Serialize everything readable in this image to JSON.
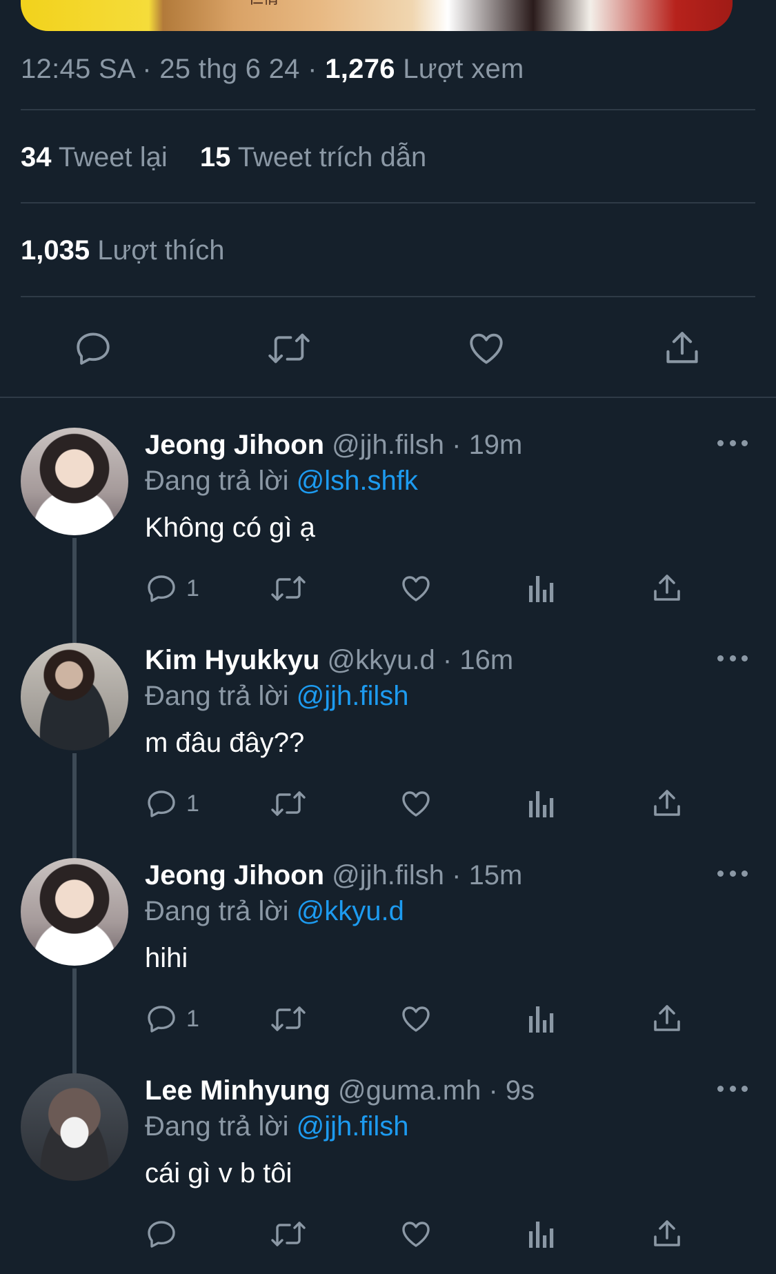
{
  "header": {
    "time": "12:45 SA",
    "date": "25 thg 6 24",
    "views_count": "1,276",
    "views_label": "Lượt xem",
    "retweets_count": "34",
    "retweets_label": "Tweet lại",
    "quotes_count": "15",
    "quotes_label": "Tweet trích dẫn",
    "likes_count": "1,035",
    "likes_label": "Lượt thích",
    "media_caption": "仁情"
  },
  "colors": {
    "background": "#15202b",
    "secondary_text": "#8b98a5",
    "accent": "#1d9bf0",
    "divider": "#2f3b47"
  },
  "replying_to_label": "Đang trả lời",
  "replies": [
    {
      "name": "Jeong Jihoon",
      "handle": "@jjh.filsh",
      "time": "19m",
      "reply_to": "@lsh.shfk",
      "text": "Không có gì ạ",
      "reply_count": "1"
    },
    {
      "name": "Kim Hyukkyu",
      "handle": "@kkyu.d",
      "time": "16m",
      "reply_to": "@jjh.filsh",
      "text": "m đâu đây??",
      "reply_count": "1"
    },
    {
      "name": "Jeong Jihoon",
      "handle": "@jjh.filsh",
      "time": "15m",
      "reply_to": "@kkyu.d",
      "text": "hihi",
      "reply_count": "1"
    },
    {
      "name": "Lee Minhyung",
      "handle": "@guma.mh",
      "time": "9s",
      "reply_to": "@jjh.filsh",
      "text": "cái gì v b tôi",
      "reply_count": ""
    }
  ],
  "icons": {
    "reply": "reply-icon",
    "retweet": "retweet-icon",
    "like": "heart-icon",
    "share": "share-icon",
    "views": "analytics-icon",
    "more": "more-icon"
  }
}
